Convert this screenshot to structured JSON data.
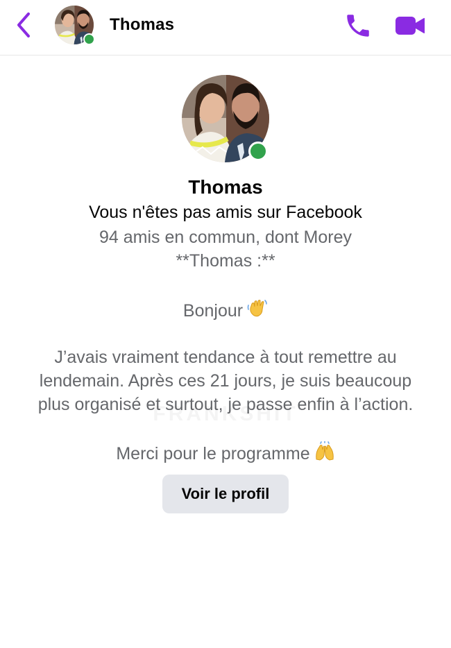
{
  "header": {
    "name": "Thomas",
    "presence": "online",
    "icons": {
      "back": "chevron-left-icon",
      "call": "phone-icon",
      "video": "video-camera-icon"
    },
    "accent_color": "#8a2be2"
  },
  "profile": {
    "name": "Thomas",
    "friend_status": "Vous n'êtes pas amis sur Facebook",
    "mutual_friends": "94 amis en commun, dont Morey",
    "presence_color": "#31a24c"
  },
  "message": {
    "author_line": "**Thomas :**",
    "greeting": "Bonjour",
    "greeting_emoji": "waving-hand-emoji",
    "body_lines": [
      "J’avais vraiment tendance à tout remettre au",
      "lendemain. Après ces 21 jours, je suis beaucoup",
      "plus organisé et surtout, je passe enfin à l’action."
    ],
    "thanks": "Merci pour le programme",
    "thanks_emoji": "raising-hands-emoji"
  },
  "watermark": "FRANKSHIT",
  "actions": {
    "view_profile_label": "Voir le profil"
  }
}
